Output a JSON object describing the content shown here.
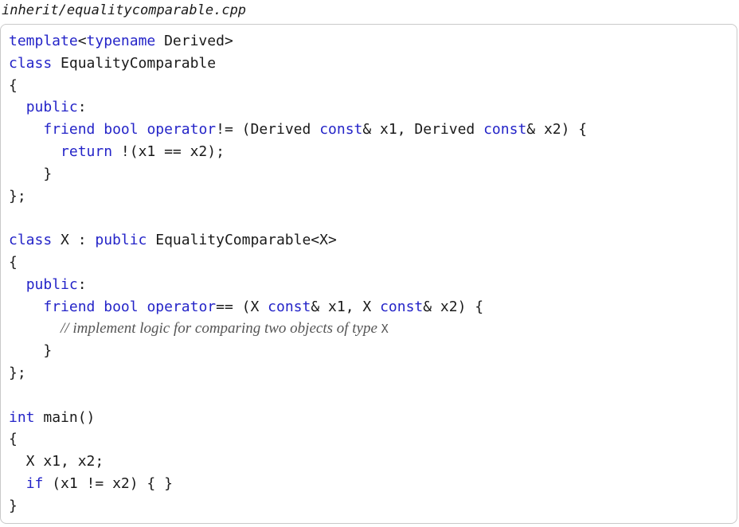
{
  "filename": "inherit/equalitycomparable.cpp",
  "code_lines": [
    [
      [
        "kw",
        "template"
      ],
      [
        "txt",
        "<"
      ],
      [
        "kw",
        "typename"
      ],
      [
        "txt",
        " Derived>"
      ]
    ],
    [
      [
        "kw",
        "class"
      ],
      [
        "txt",
        " EqualityComparable"
      ]
    ],
    [
      [
        "txt",
        "{"
      ]
    ],
    [
      [
        "txt",
        "  "
      ],
      [
        "kw",
        "public"
      ],
      [
        "txt",
        ":"
      ]
    ],
    [
      [
        "txt",
        "    "
      ],
      [
        "kw",
        "friend"
      ],
      [
        "txt",
        " "
      ],
      [
        "kw",
        "bool"
      ],
      [
        "txt",
        " "
      ],
      [
        "kw",
        "operator"
      ],
      [
        "txt",
        "!= (Derived "
      ],
      [
        "kw",
        "const"
      ],
      [
        "txt",
        "& x1, Derived "
      ],
      [
        "kw",
        "const"
      ],
      [
        "txt",
        "& x2) {"
      ]
    ],
    [
      [
        "txt",
        "      "
      ],
      [
        "kw",
        "return"
      ],
      [
        "txt",
        " !(x1 == x2);"
      ]
    ],
    [
      [
        "txt",
        "    }"
      ]
    ],
    [
      [
        "txt",
        "};"
      ]
    ],
    [],
    [
      [
        "kw",
        "class"
      ],
      [
        "txt",
        " X : "
      ],
      [
        "kw",
        "public"
      ],
      [
        "txt",
        " EqualityComparable<X>"
      ]
    ],
    [
      [
        "txt",
        "{"
      ]
    ],
    [
      [
        "txt",
        "  "
      ],
      [
        "kw",
        "public"
      ],
      [
        "txt",
        ":"
      ]
    ],
    [
      [
        "txt",
        "    "
      ],
      [
        "kw",
        "friend"
      ],
      [
        "txt",
        " "
      ],
      [
        "kw",
        "bool"
      ],
      [
        "txt",
        " "
      ],
      [
        "kw",
        "operator"
      ],
      [
        "txt",
        "== (X "
      ],
      [
        "kw",
        "const"
      ],
      [
        "txt",
        "& x1, X "
      ],
      [
        "kw",
        "const"
      ],
      [
        "txt",
        "& x2) {"
      ]
    ],
    [
      [
        "txt",
        "      "
      ],
      [
        "cm",
        "// implement logic for comparing two objects of type "
      ],
      [
        "cmcode",
        "X"
      ]
    ],
    [
      [
        "txt",
        "    }"
      ]
    ],
    [
      [
        "txt",
        "};"
      ]
    ],
    [],
    [
      [
        "kw",
        "int"
      ],
      [
        "txt",
        " main()"
      ]
    ],
    [
      [
        "txt",
        "{"
      ]
    ],
    [
      [
        "txt",
        "  X x1, x2;"
      ]
    ],
    [
      [
        "txt",
        "  "
      ],
      [
        "kw",
        "if"
      ],
      [
        "txt",
        " (x1 != x2) { }"
      ]
    ],
    [
      [
        "txt",
        "}"
      ]
    ]
  ]
}
